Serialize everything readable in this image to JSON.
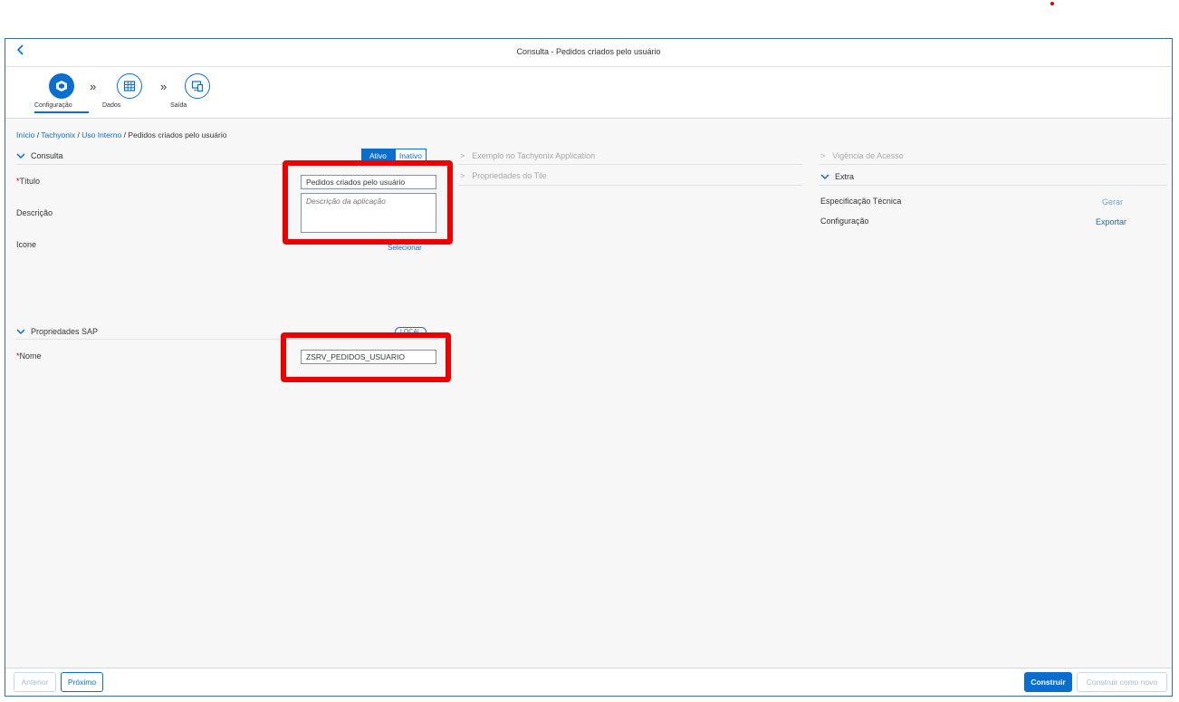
{
  "window": {
    "title": "Consulta - Pedidos criados pelo usuário",
    "back_icon": "chevron-left-icon"
  },
  "wizard": {
    "steps": [
      {
        "label": "Configuração",
        "icon": "cube-icon",
        "active": true
      },
      {
        "label": "Dados",
        "icon": "table-grid-icon",
        "active": false
      },
      {
        "label": "Saída",
        "icon": "devices-icon",
        "active": false
      }
    ],
    "separator": "»"
  },
  "breadcrumb": {
    "items": [
      "Início",
      "Tachyonix",
      "Uso Interno"
    ],
    "current": "Pedidos criados pelo usuário",
    "separator": "/"
  },
  "consulta": {
    "header": "Consulta",
    "toggle": {
      "active": "Ativo",
      "inactive": "Inativo"
    },
    "fields": {
      "title_label": "Título",
      "title_value": "Pedidos criados pelo usuário",
      "description_label": "Descrição",
      "description_placeholder": "Descrição da aplicação",
      "icon_label": "Icone",
      "icon_action": "Selecionar"
    }
  },
  "sap": {
    "header": "Propriedades SAP",
    "badge": "LOCAL",
    "name_label": "Nome",
    "name_value": "ZSRV_PEDIDOS_USUARIO"
  },
  "middle_sections": {
    "example": "Exemplo no Tachyonix Application",
    "tile_props": "Propriedades do Tile"
  },
  "right": {
    "vigencia": "Vigência de Acesso",
    "extra": "Extra",
    "rows": [
      {
        "label": "Especificação Técnica",
        "action": "Gerar"
      },
      {
        "label": "Configuração",
        "action": "Exportar"
      }
    ]
  },
  "footer": {
    "previous": "Anterior",
    "next": "Próximo",
    "build": "Construir",
    "build_new": "Construir como novo"
  },
  "colors": {
    "accent": "#0a6ed1",
    "highlight": "#ee0000",
    "required": "#bb0000"
  }
}
